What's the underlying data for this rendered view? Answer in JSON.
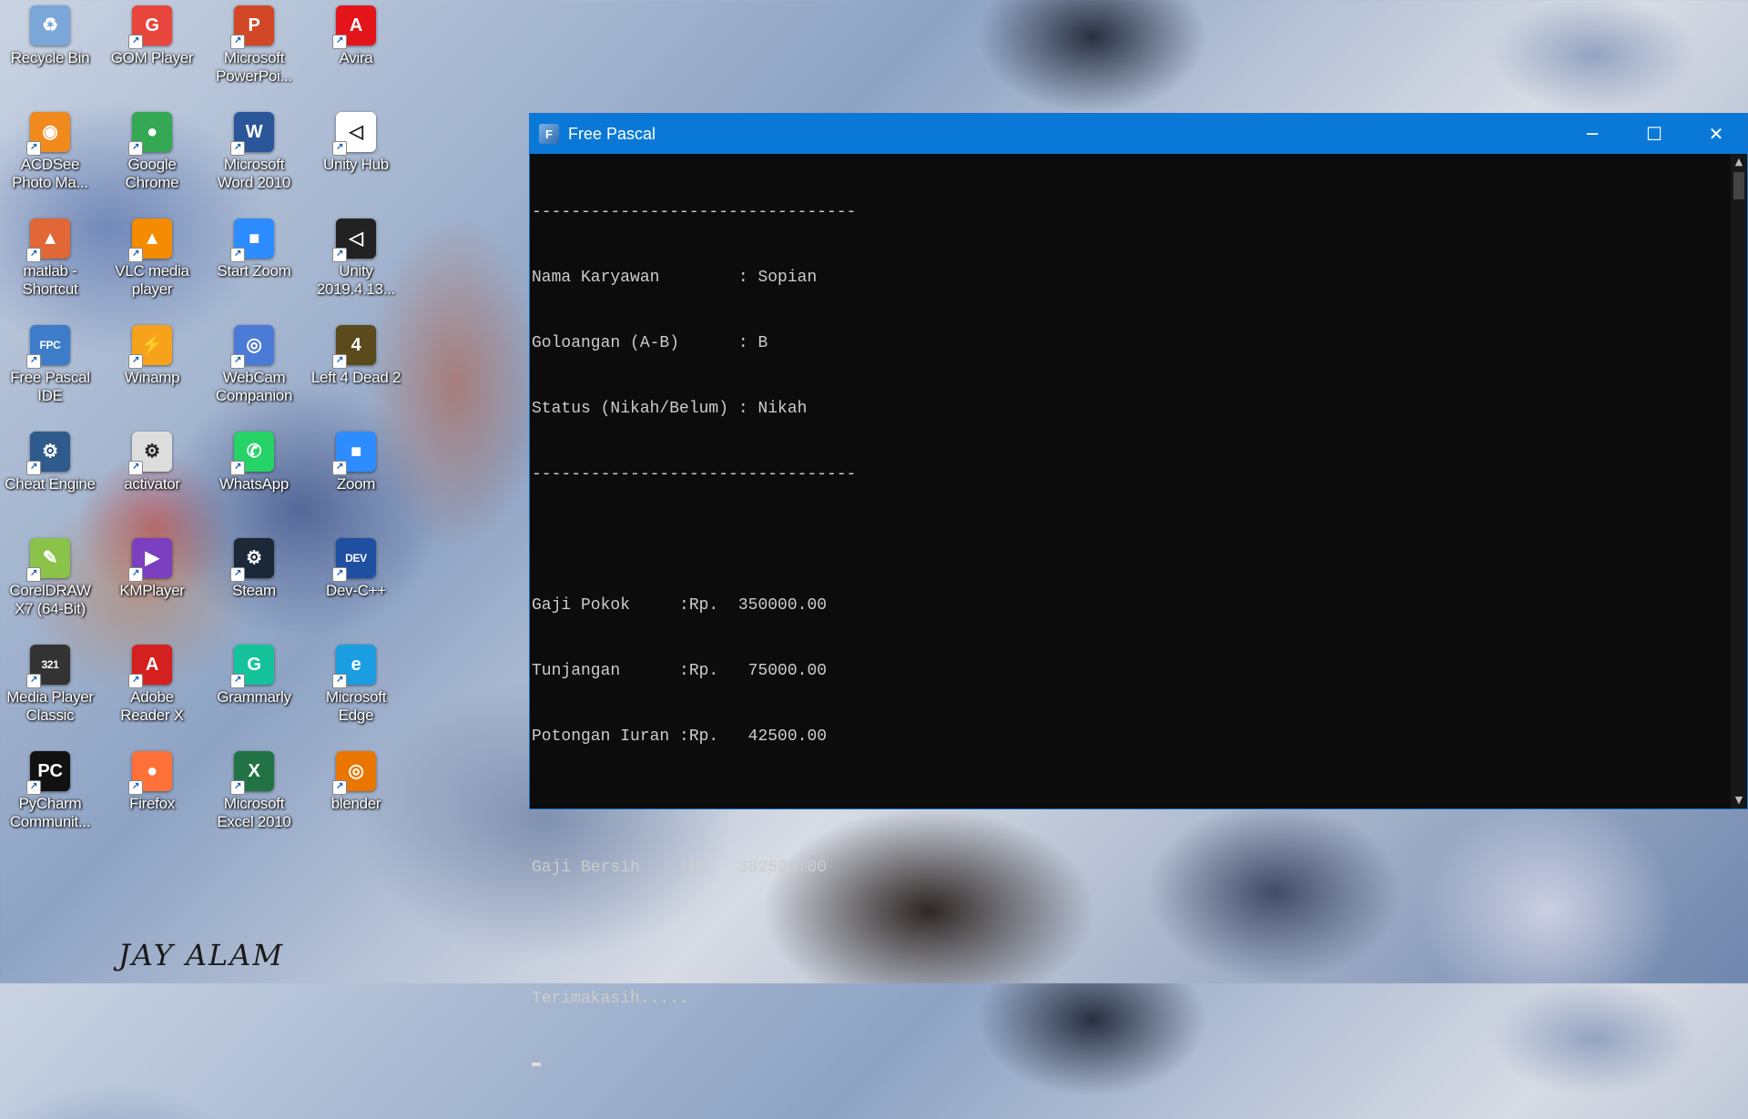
{
  "desktop": {
    "icons": [
      {
        "label": "Recycle Bin",
        "icon": "recycle-bin-icon",
        "color": "#7aa6d8",
        "glyph": "♻"
      },
      {
        "label": "GOM Player",
        "icon": "gom-player-icon",
        "color": "#e8453c",
        "glyph": "G"
      },
      {
        "label": "Microsoft PowerPoi...",
        "icon": "powerpoint-icon",
        "color": "#d24726",
        "glyph": "P"
      },
      {
        "label": "Avira",
        "icon": "avira-icon",
        "color": "#e3151a",
        "glyph": "A"
      },
      {
        "label": "ACDSee Photo Ma...",
        "icon": "acdsee-icon",
        "color": "#f08a1c",
        "glyph": "◉"
      },
      {
        "label": "Google Chrome",
        "icon": "chrome-icon",
        "color": "#34a853",
        "glyph": "●"
      },
      {
        "label": "Microsoft Word 2010",
        "icon": "word-icon",
        "color": "#2b579a",
        "glyph": "W"
      },
      {
        "label": "Unity Hub",
        "icon": "unity-hub-icon",
        "color": "#ffffff",
        "glyph": "◁"
      },
      {
        "label": "matlab - Shortcut",
        "icon": "matlab-icon",
        "color": "#e16737",
        "glyph": "▲"
      },
      {
        "label": "VLC media player",
        "icon": "vlc-icon",
        "color": "#f48b00",
        "glyph": "▲"
      },
      {
        "label": "Start Zoom",
        "icon": "zoom-start-icon",
        "color": "#2d8cff",
        "glyph": "■"
      },
      {
        "label": "Unity 2019.4.13...",
        "icon": "unity-icon",
        "color": "#222222",
        "glyph": "◁"
      },
      {
        "label": "Free Pascal IDE",
        "icon": "free-pascal-icon",
        "color": "#3d7cc9",
        "glyph": "FPC"
      },
      {
        "label": "Winamp",
        "icon": "winamp-icon",
        "color": "#f7a21b",
        "glyph": "⚡"
      },
      {
        "label": "WebCam Companion",
        "icon": "webcam-icon",
        "color": "#4b7bd6",
        "glyph": "◎"
      },
      {
        "label": "Left 4 Dead 2",
        "icon": "left4dead-icon",
        "color": "#5b4a1c",
        "glyph": "4"
      },
      {
        "label": "Cheat Engine",
        "icon": "cheat-engine-icon",
        "color": "#2e5a8c",
        "glyph": "⚙"
      },
      {
        "label": "activator",
        "icon": "activator-icon",
        "color": "#dddddd",
        "glyph": "⚙"
      },
      {
        "label": "WhatsApp",
        "icon": "whatsapp-icon",
        "color": "#25d366",
        "glyph": "✆"
      },
      {
        "label": "Zoom",
        "icon": "zoom-icon",
        "color": "#2d8cff",
        "glyph": "■"
      },
      {
        "label": "CorelDRAW X7 (64-Bit)",
        "icon": "coreldraw-icon",
        "color": "#8bc34a",
        "glyph": "✎"
      },
      {
        "label": "KMPlayer",
        "icon": "kmplayer-icon",
        "color": "#7b3fbf",
        "glyph": "▶"
      },
      {
        "label": "Steam",
        "icon": "steam-icon",
        "color": "#1b2838",
        "glyph": "⚙"
      },
      {
        "label": "Dev-C++",
        "icon": "devcpp-icon",
        "color": "#1f4fa0",
        "glyph": "DEV"
      },
      {
        "label": "Media Player Classic",
        "icon": "media-player-classic-icon",
        "color": "#333333",
        "glyph": "321"
      },
      {
        "label": "Adobe Reader X",
        "icon": "adobe-reader-icon",
        "color": "#d4201f",
        "glyph": "A"
      },
      {
        "label": "Grammarly",
        "icon": "grammarly-icon",
        "color": "#15c39a",
        "glyph": "G"
      },
      {
        "label": "Microsoft Edge",
        "icon": "edge-icon",
        "color": "#1b9de2",
        "glyph": "e"
      },
      {
        "label": "PyCharm Communit...",
        "icon": "pycharm-icon",
        "color": "#111111",
        "glyph": "PC"
      },
      {
        "label": "Firefox",
        "icon": "firefox-icon",
        "color": "#ff7139",
        "glyph": "●"
      },
      {
        "label": "Microsoft Excel 2010",
        "icon": "excel-icon",
        "color": "#217346",
        "glyph": "X"
      },
      {
        "label": "blender",
        "icon": "blender-icon",
        "color": "#ea7600",
        "glyph": "◎"
      }
    ],
    "signature": "JAY ALAM"
  },
  "window": {
    "title": "Free Pascal",
    "minimize": "─",
    "maximize": "☐",
    "close": "✕",
    "console_lines": [
      "---------------------------------",
      "Nama Karyawan        : Sopian",
      "Goloangan (A-B)      : B",
      "Status (Nikah/Belum) : Nikah",
      "---------------------------------",
      "",
      "Gaji Pokok     :Rp.  350000.00",
      "Tunjangan      :Rp.   75000.00",
      "Potongan Iuran :Rp.   42500.00",
      "",
      "Gaji Bersih    :Rp.  382500.00",
      "",
      "Terimakasih....."
    ]
  }
}
